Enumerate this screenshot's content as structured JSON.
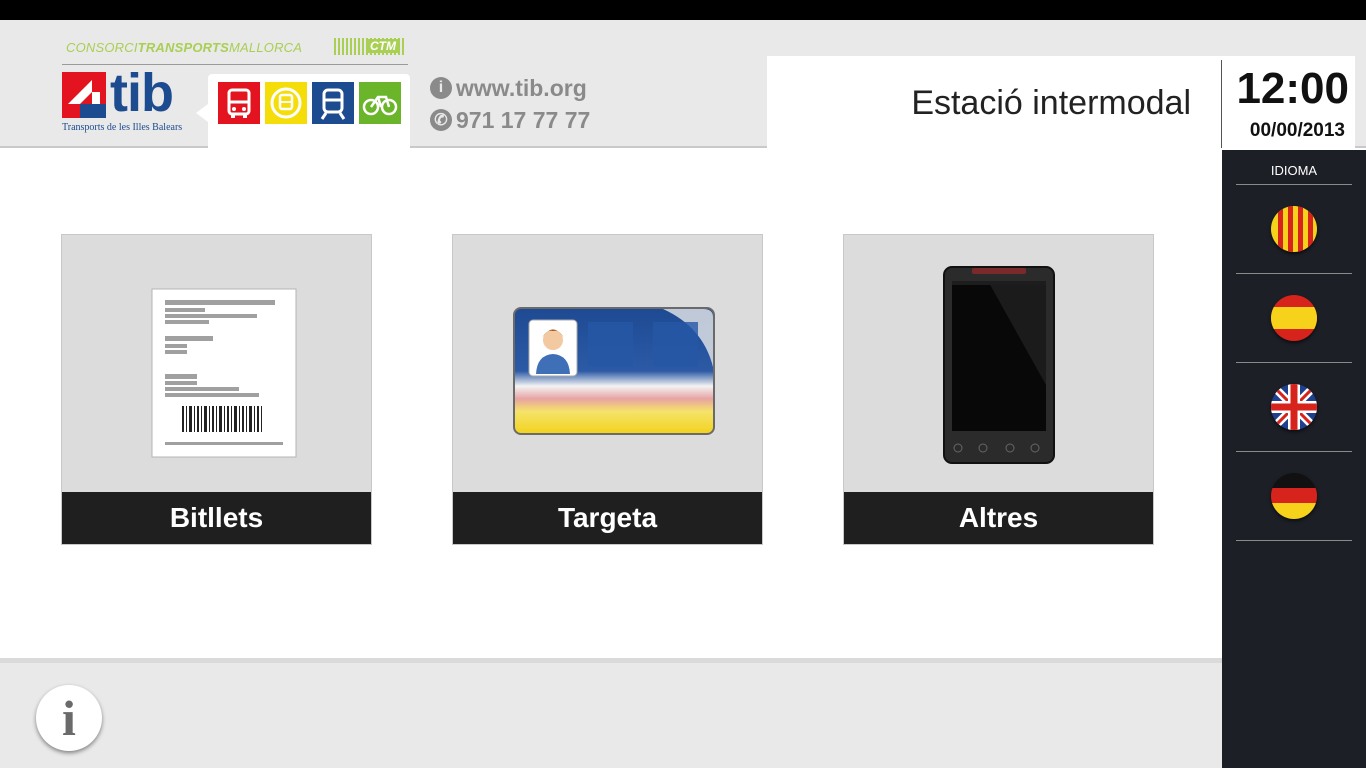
{
  "header": {
    "consorci_light": "CONSORCI",
    "consorci_bold": "TRANSPORTS",
    "consorci_end": "MALLORCA",
    "ctm": "CTM",
    "brand": "tib",
    "brand_subtitle": "Transports de les Illes Balears",
    "website": "www.tib.org",
    "phone": "971 17 77 77",
    "station": "Estació intermodal",
    "time": "12:00",
    "date": "00/00/2013"
  },
  "modes": [
    {
      "icon": "bus-icon",
      "color": "#e3141f"
    },
    {
      "icon": "metro-icon",
      "color": "#f5dd0a"
    },
    {
      "icon": "train-icon",
      "color": "#1d4b8f"
    },
    {
      "icon": "bicycle-icon",
      "color": "#6bb52b"
    }
  ],
  "tiles": [
    {
      "label": "Bitllets",
      "icon": "ticket-icon"
    },
    {
      "label": "Targeta",
      "icon": "card-icon"
    },
    {
      "label": "Altres",
      "icon": "smartphone-icon"
    }
  ],
  "sidebar": {
    "title": "IDIOMA",
    "languages": [
      {
        "name": "catalan",
        "icon": "catalan-flag-icon"
      },
      {
        "name": "spanish",
        "icon": "spanish-flag-icon"
      },
      {
        "name": "english",
        "icon": "uk-flag-icon"
      },
      {
        "name": "german",
        "icon": "german-flag-icon"
      }
    ]
  },
  "footer": {
    "info_glyph": "i"
  },
  "colors": {
    "brand_blue": "#1d4b8f",
    "brand_red": "#e3141f",
    "ctm_green": "#a9cf54",
    "dark": "#1f1f1f",
    "sidebar": "#1c1f26"
  }
}
